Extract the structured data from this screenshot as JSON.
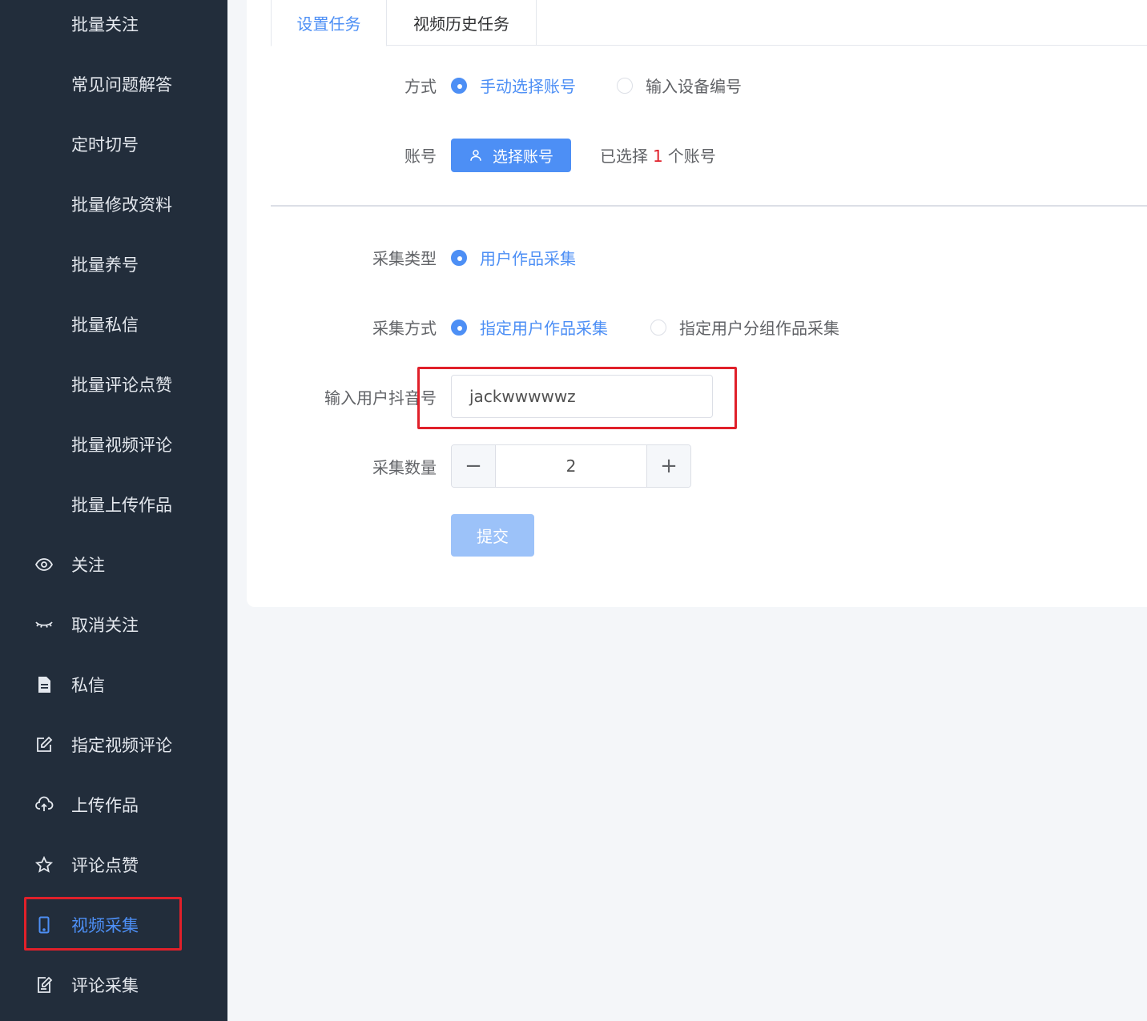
{
  "sidebar": {
    "items": [
      {
        "label": "批量关注",
        "icon": ""
      },
      {
        "label": "常见问题解答",
        "icon": ""
      },
      {
        "label": "定时切号",
        "icon": ""
      },
      {
        "label": "批量修改资料",
        "icon": ""
      },
      {
        "label": "批量养号",
        "icon": ""
      },
      {
        "label": "批量私信",
        "icon": ""
      },
      {
        "label": "批量评论点赞",
        "icon": ""
      },
      {
        "label": "批量视频评论",
        "icon": ""
      },
      {
        "label": "批量上传作品",
        "icon": ""
      },
      {
        "label": "关注",
        "icon": "eye-icon"
      },
      {
        "label": "取消关注",
        "icon": "eye-closed-icon"
      },
      {
        "label": "私信",
        "icon": "document-icon"
      },
      {
        "label": "指定视频评论",
        "icon": "edit-icon"
      },
      {
        "label": "上传作品",
        "icon": "cloud-upload-icon"
      },
      {
        "label": "评论点赞",
        "icon": "star-icon"
      },
      {
        "label": "视频采集",
        "icon": "mobile-icon",
        "active": true
      },
      {
        "label": "评论采集",
        "icon": "edit-note-icon"
      }
    ]
  },
  "tabs": [
    {
      "label": "设置任务",
      "active": true
    },
    {
      "label": "视频历史任务",
      "active": false
    }
  ],
  "form": {
    "mode_label": "方式",
    "mode_options": [
      "手动选择账号",
      "输入设备编号"
    ],
    "account_label": "账号",
    "select_account_button": "选择账号",
    "selected_prefix": "已选择",
    "selected_count": "1",
    "selected_suffix": "个账号",
    "collect_type_label": "采集类型",
    "collect_type_option": "用户作品采集",
    "collect_method_label": "采集方式",
    "collect_method_options": [
      "指定用户作品采集",
      "指定用户分组作品采集"
    ],
    "douyin_id_label": "输入用户抖音号",
    "douyin_id_value": "jackwwwwwz",
    "count_label": "采集数量",
    "count_value": "2",
    "minus_symbol": "−",
    "plus_symbol": "+",
    "submit_button": "提交"
  },
  "colors": {
    "sidebar_bg": "#222d3b",
    "accent": "#4d8ff5",
    "highlight": "#e0202a"
  }
}
